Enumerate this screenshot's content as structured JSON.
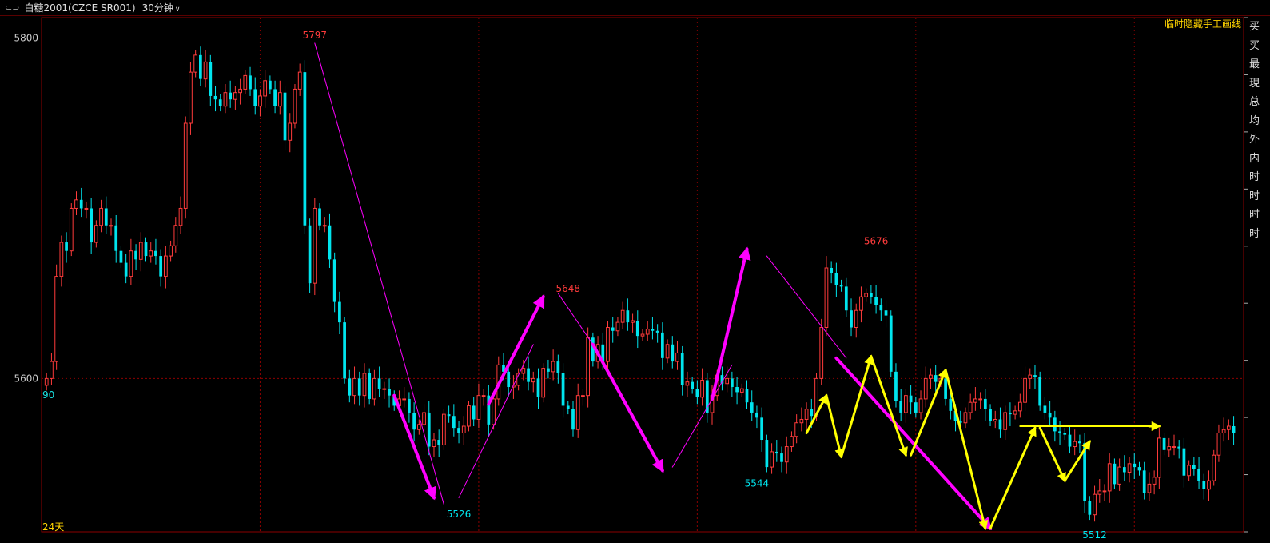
{
  "header": {
    "symbol": "白糖2001(CZCE SR001)",
    "period": "30分钟",
    "chevron": "v",
    "link_icon": "link-icon"
  },
  "top_note": "临时隐藏手工画线",
  "side_chars": [
    "买",
    "买",
    "最",
    "現",
    "总",
    "均",
    "外",
    "内",
    "时",
    "时",
    "时",
    "时"
  ],
  "bottom_label": "24天",
  "left_value": "90",
  "colors": {
    "up": "#ff3b3b",
    "down": "#00e5ee",
    "magenta": "#ff00ff",
    "yellow": "#ffff00",
    "grid": "#8b0000",
    "peak_label": "#ff3b3b",
    "trough_label": "#00e5ee"
  },
  "chart_data": {
    "type": "candlestick",
    "title": "白糖2001(CZCE SR001) 30分钟",
    "y_ticks": [
      5600,
      5800
    ],
    "ylim": [
      5510,
      5812
    ],
    "x_count": 244,
    "grid": true,
    "closes": [
      5600,
      5610,
      5660,
      5680,
      5675,
      5700,
      5705,
      5700,
      5700,
      5680,
      5690,
      5700,
      5690,
      5690,
      5675,
      5668,
      5660,
      5675,
      5670,
      5680,
      5672,
      5675,
      5672,
      5660,
      5672,
      5678,
      5690,
      5700,
      5750,
      5780,
      5790,
      5776,
      5786,
      5766,
      5764,
      5760,
      5768,
      5764,
      5768,
      5770,
      5778,
      5770,
      5760,
      5766,
      5775,
      5770,
      5760,
      5768,
      5740,
      5750,
      5770,
      5780,
      5690,
      5656,
      5700,
      5690,
      5690,
      5670,
      5645,
      5633,
      5600,
      5590,
      5600,
      5590,
      5603,
      5588,
      5600,
      5594,
      5594,
      5590,
      5584,
      5588,
      5588,
      5580,
      5570,
      5573,
      5580,
      5560,
      5564,
      5561,
      5579,
      5578,
      5571,
      5568,
      5572,
      5584,
      5576,
      5590,
      5590,
      5573,
      5588,
      5608,
      5604,
      5595,
      5596,
      5603,
      5606,
      5598,
      5600,
      5589,
      5606,
      5604,
      5610,
      5603,
      5584,
      5582,
      5570,
      5590,
      5590,
      5624,
      5610,
      5620,
      5610,
      5630,
      5628,
      5633,
      5640,
      5633,
      5634,
      5625,
      5626,
      5629,
      5628,
      5627,
      5612,
      5620,
      5610,
      5615,
      5596,
      5598,
      5594,
      5589,
      5599,
      5580,
      5590,
      5602,
      5597,
      5600,
      5595,
      5592,
      5594,
      5586,
      5580,
      5577,
      5564,
      5548,
      5557,
      5556,
      5551,
      5560,
      5566,
      5574,
      5576,
      5582,
      5578,
      5600,
      5630,
      5665,
      5662,
      5655,
      5654,
      5640,
      5630,
      5640,
      5648,
      5650,
      5648,
      5643,
      5640,
      5637,
      5604,
      5587,
      5580,
      5590,
      5586,
      5580,
      5588,
      5600,
      5602,
      5598,
      5600,
      5588,
      5581,
      5575,
      5574,
      5580,
      5586,
      5588,
      5588,
      5582,
      5575,
      5576,
      5570,
      5580,
      5579,
      5581,
      5586,
      5600,
      5602,
      5601,
      5584,
      5580,
      5577,
      5569,
      5568,
      5567,
      5560,
      5563,
      5562,
      5528,
      5520,
      5532,
      5534,
      5534,
      5550,
      5538,
      5548,
      5545,
      5550,
      5548,
      5546,
      5533,
      5538,
      5542,
      5565,
      5558,
      5560,
      5560,
      5559,
      5543,
      5549,
      5547,
      5540,
      5535,
      5540,
      5555,
      5568,
      5570,
      5572,
      5568
    ],
    "label_x": [
      "5797",
      "5648",
      "5526",
      "5544",
      "5676",
      "5512"
    ],
    "annotations": [
      {
        "text": "5797",
        "kind": "peak",
        "index": 54,
        "value": 5797
      },
      {
        "text": "5526",
        "kind": "trough",
        "index": 83,
        "value": 5526
      },
      {
        "text": "5648",
        "kind": "peak",
        "index": 105,
        "value": 5648
      },
      {
        "text": "5544",
        "kind": "trough",
        "index": 143,
        "value": 5544
      },
      {
        "text": "5676",
        "kind": "peak",
        "index": 167,
        "value": 5676
      },
      {
        "text": "5512",
        "kind": "trough",
        "index": 211,
        "value": 5512
      }
    ],
    "lines": [
      {
        "color": "magenta",
        "width": 1,
        "arrow": false,
        "from": [
          54,
          5797
        ],
        "to": [
          80,
          5526
        ]
      },
      {
        "color": "magenta",
        "width": 4,
        "arrow": true,
        "from": [
          70,
          5590
        ],
        "to": [
          78,
          5530
        ]
      },
      {
        "color": "magenta",
        "width": 1,
        "arrow": false,
        "from": [
          83,
          5530
        ],
        "to": [
          98,
          5620
        ]
      },
      {
        "color": "magenta",
        "width": 4,
        "arrow": true,
        "from": [
          89,
          5585
        ],
        "to": [
          100,
          5648
        ]
      },
      {
        "color": "magenta",
        "width": 1,
        "arrow": false,
        "from": [
          103,
          5650
        ],
        "to": [
          110,
          5620
        ]
      },
      {
        "color": "magenta",
        "width": 4,
        "arrow": true,
        "from": [
          110,
          5620
        ],
        "to": [
          124,
          5546
        ]
      },
      {
        "color": "magenta",
        "width": 1,
        "arrow": false,
        "from": [
          126,
          5548
        ],
        "to": [
          138,
          5608
        ]
      },
      {
        "color": "magenta",
        "width": 4,
        "arrow": true,
        "from": [
          134,
          5588
        ],
        "to": [
          141,
          5676
        ]
      },
      {
        "color": "magenta",
        "width": 1,
        "arrow": false,
        "from": [
          145,
          5672
        ],
        "to": [
          161,
          5612
        ]
      },
      {
        "color": "magenta",
        "width": 4,
        "arrow": true,
        "from": [
          159,
          5612
        ],
        "to": [
          190,
          5512
        ]
      },
      {
        "color": "yellow",
        "width": 3,
        "arrow": true,
        "from": [
          153,
          5568
        ],
        "to": [
          157,
          5590
        ]
      },
      {
        "color": "yellow",
        "width": 3,
        "arrow": true,
        "from": [
          157,
          5590
        ],
        "to": [
          160,
          5554
        ]
      },
      {
        "color": "yellow",
        "width": 3,
        "arrow": true,
        "from": [
          160,
          5554
        ],
        "to": [
          166,
          5613
        ]
      },
      {
        "color": "yellow",
        "width": 3,
        "arrow": true,
        "from": [
          166,
          5613
        ],
        "to": [
          173,
          5555
        ]
      },
      {
        "color": "yellow",
        "width": 3,
        "arrow": true,
        "from": [
          174,
          5555
        ],
        "to": [
          181,
          5605
        ]
      },
      {
        "color": "yellow",
        "width": 3,
        "arrow": true,
        "from": [
          181,
          5605
        ],
        "to": [
          189,
          5512
        ]
      },
      {
        "color": "yellow",
        "width": 3,
        "arrow": true,
        "from": [
          190,
          5512
        ],
        "to": [
          199,
          5571
        ]
      },
      {
        "color": "yellow",
        "width": 2,
        "arrow": false,
        "from": [
          196,
          5572
        ],
        "to": [
          222,
          5572
        ]
      },
      {
        "color": "yellow",
        "width": 3,
        "arrow": true,
        "from": [
          200,
          5571
        ],
        "to": [
          205,
          5540
        ]
      },
      {
        "color": "yellow",
        "width": 3,
        "arrow": true,
        "from": [
          205,
          5540
        ],
        "to": [
          210,
          5563
        ]
      },
      {
        "color": "yellow",
        "width": 3,
        "arrow": true,
        "from": [
          222,
          5572
        ],
        "to": [
          224,
          5572
        ]
      }
    ]
  }
}
